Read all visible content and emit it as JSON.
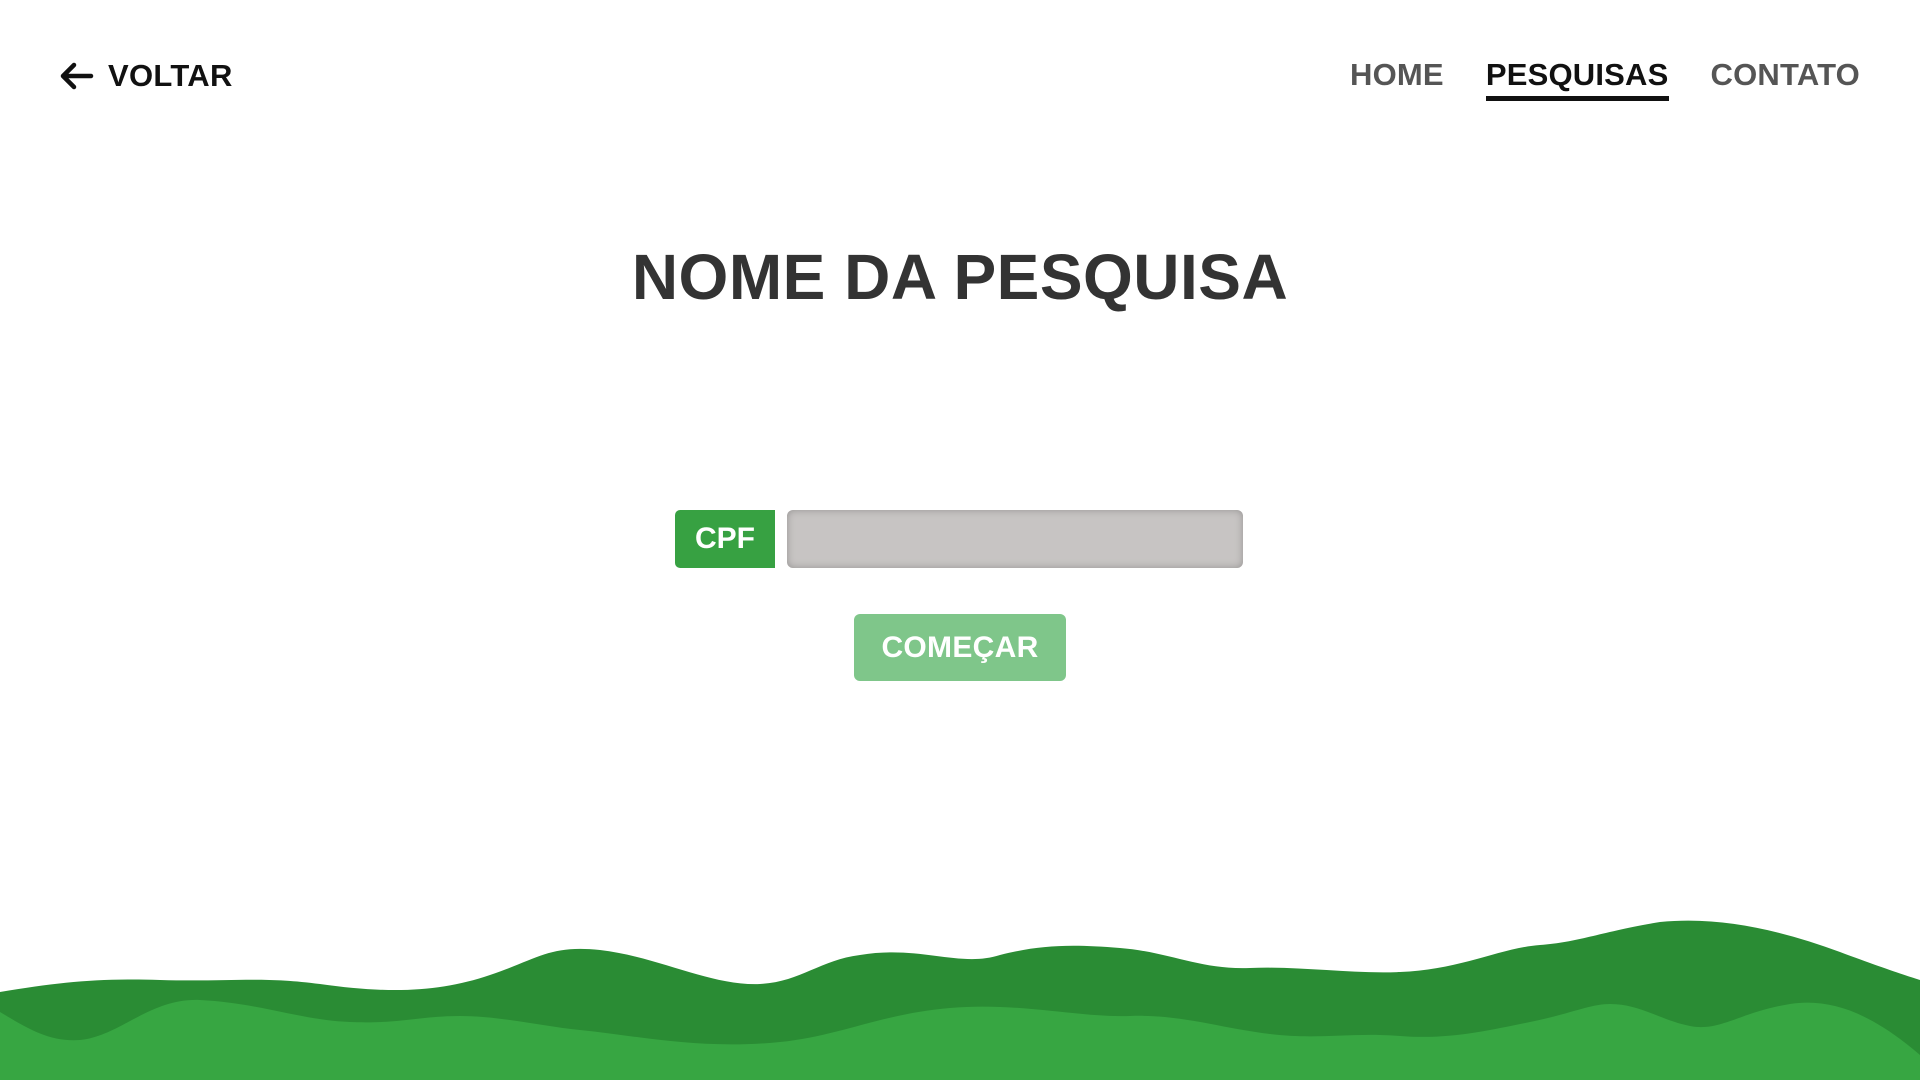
{
  "header": {
    "back_label": "VOLTAR",
    "back_icon": "arrow-left-icon",
    "nav": [
      {
        "label": "HOME",
        "active": false
      },
      {
        "label": "PESQUISAS",
        "active": true
      },
      {
        "label": "CONTATO",
        "active": false
      }
    ]
  },
  "main": {
    "title": "NOME DA PESQUISA",
    "cpf_label": "CPF",
    "cpf_value": "",
    "start_button": "COMEÇAR"
  },
  "colors": {
    "dark_green": "#2a8c34",
    "light_green": "#37a642",
    "button_green": "#7fc68a",
    "input_gray": "#c7c4c3"
  }
}
